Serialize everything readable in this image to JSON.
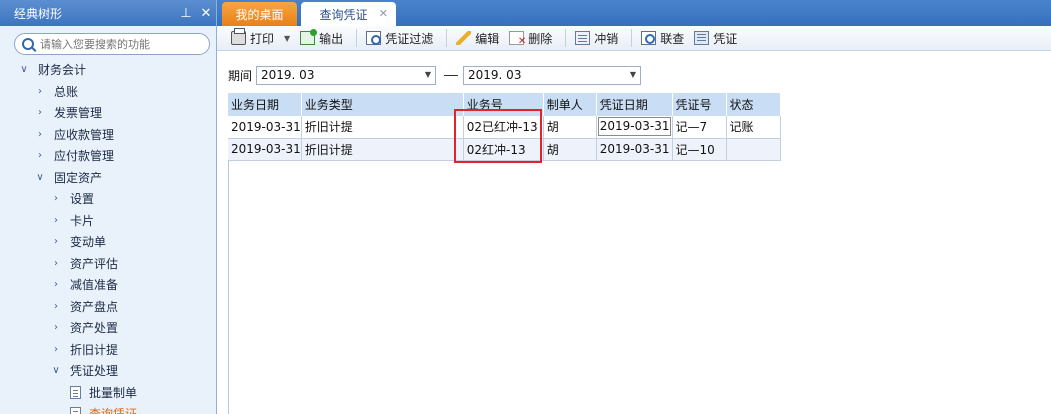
{
  "sidebar": {
    "title": "经典树形",
    "search_placeholder": "请输入您要搜索的功能",
    "tree": [
      {
        "label": "财务会计",
        "level": 0,
        "expanded": true,
        "id": "caiwu"
      },
      {
        "label": "总账",
        "level": 1,
        "expanded": false,
        "id": "zongzhang"
      },
      {
        "label": "发票管理",
        "level": 1,
        "expanded": false,
        "id": "fapiao"
      },
      {
        "label": "应收款管理",
        "level": 1,
        "expanded": false,
        "id": "yingshou"
      },
      {
        "label": "应付款管理",
        "level": 1,
        "expanded": false,
        "id": "yingfu"
      },
      {
        "label": "固定资产",
        "level": 1,
        "expanded": true,
        "id": "guding"
      },
      {
        "label": "设置",
        "level": 2,
        "expanded": false,
        "id": "shezhi"
      },
      {
        "label": "卡片",
        "level": 2,
        "expanded": false,
        "id": "kapian"
      },
      {
        "label": "变动单",
        "level": 2,
        "expanded": false,
        "id": "biandong"
      },
      {
        "label": "资产评估",
        "level": 2,
        "expanded": false,
        "id": "pinggu"
      },
      {
        "label": "减值准备",
        "level": 2,
        "expanded": false,
        "id": "jianzhi"
      },
      {
        "label": "资产盘点",
        "level": 2,
        "expanded": false,
        "id": "pandian"
      },
      {
        "label": "资产处置",
        "level": 2,
        "expanded": false,
        "id": "chuzhi"
      },
      {
        "label": "折旧计提",
        "level": 2,
        "expanded": false,
        "id": "zhejiu"
      },
      {
        "label": "凭证处理",
        "level": 2,
        "expanded": true,
        "id": "pingzheng"
      },
      {
        "label": "批量制单",
        "level": 3,
        "leaf": true,
        "id": "piliang"
      },
      {
        "label": "查询凭证",
        "level": 3,
        "leaf": true,
        "active": true,
        "id": "chaxun"
      }
    ]
  },
  "tabs": {
    "home": "我的桌面",
    "query": "查询凭证"
  },
  "toolbar": {
    "print": "打印",
    "export": "输出",
    "filter": "凭证过滤",
    "edit": "编辑",
    "delete": "删除",
    "reverse": "冲销",
    "lookup": "联查",
    "voucher": "凭证"
  },
  "filter": {
    "period_label": "期间",
    "from": "2019. 03",
    "to": "2019. 03"
  },
  "grid": {
    "columns": [
      "业务日期",
      "业务类型",
      "业务号",
      "制单人",
      "凭证日期",
      "凭证号",
      "状态"
    ],
    "rows": [
      [
        "2019-03-31",
        "折旧计提",
        "02已红冲-13",
        "胡",
        "2019-03-31",
        "记—7",
        "记账"
      ],
      [
        "2019-03-31",
        "折旧计提",
        "02红冲-13",
        "胡",
        "2019-03-31",
        "记—10",
        ""
      ]
    ]
  },
  "colors": {
    "highlight": "#e0232d",
    "active_tab": "#e8801a",
    "header_blue": "#3d74bf"
  }
}
